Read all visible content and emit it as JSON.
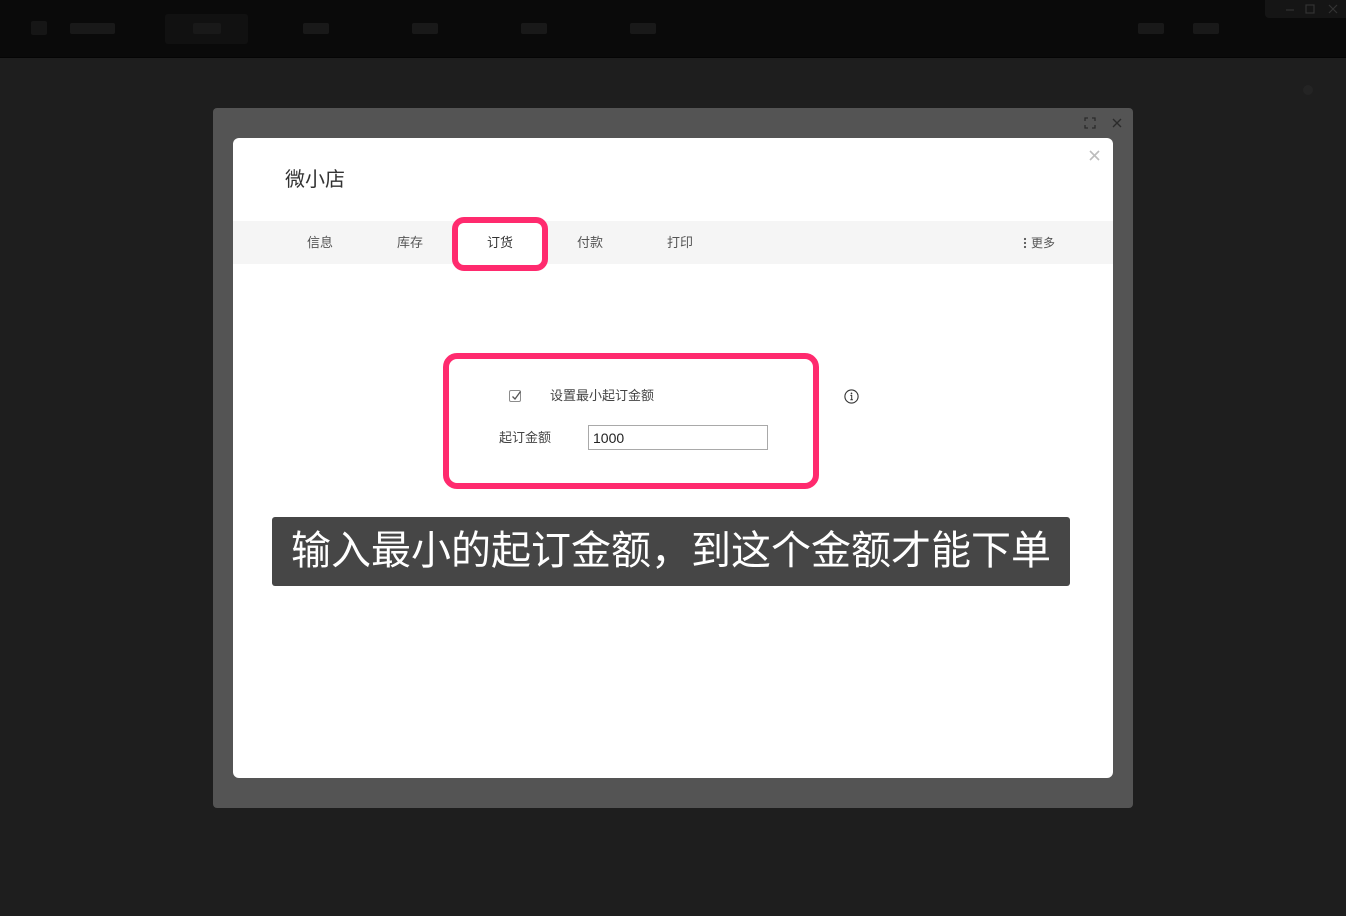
{
  "topbar": {
    "window_controls": [
      "minimize-icon",
      "maximize-icon",
      "close-icon"
    ]
  },
  "frame": {
    "expand_icon": "expand-icon",
    "close_icon": "close-icon"
  },
  "dialog": {
    "title": "微小店",
    "close_icon": "close-icon",
    "tabs": [
      {
        "label": "信息"
      },
      {
        "label": "库存"
      },
      {
        "label": "订货"
      },
      {
        "label": "付款"
      },
      {
        "label": "打印"
      }
    ],
    "active_tab_index": 2,
    "more": {
      "icon": "vertical-dots-icon",
      "label": "更多"
    }
  },
  "form": {
    "min_order_toggle": {
      "label": "设置最小起订金额",
      "checked": true,
      "icon": "checkmark-icon"
    },
    "min_order_amount": {
      "label": "起订金额",
      "value": "1000"
    },
    "info_icon": "info-icon"
  },
  "caption": {
    "text": "输入最小的起订金额，到这个金额才能下单"
  },
  "colors": {
    "highlight": "#ff2a6e",
    "overlay": "#1e1e1e",
    "frame": "#545454",
    "caption_bg": "#464646"
  }
}
